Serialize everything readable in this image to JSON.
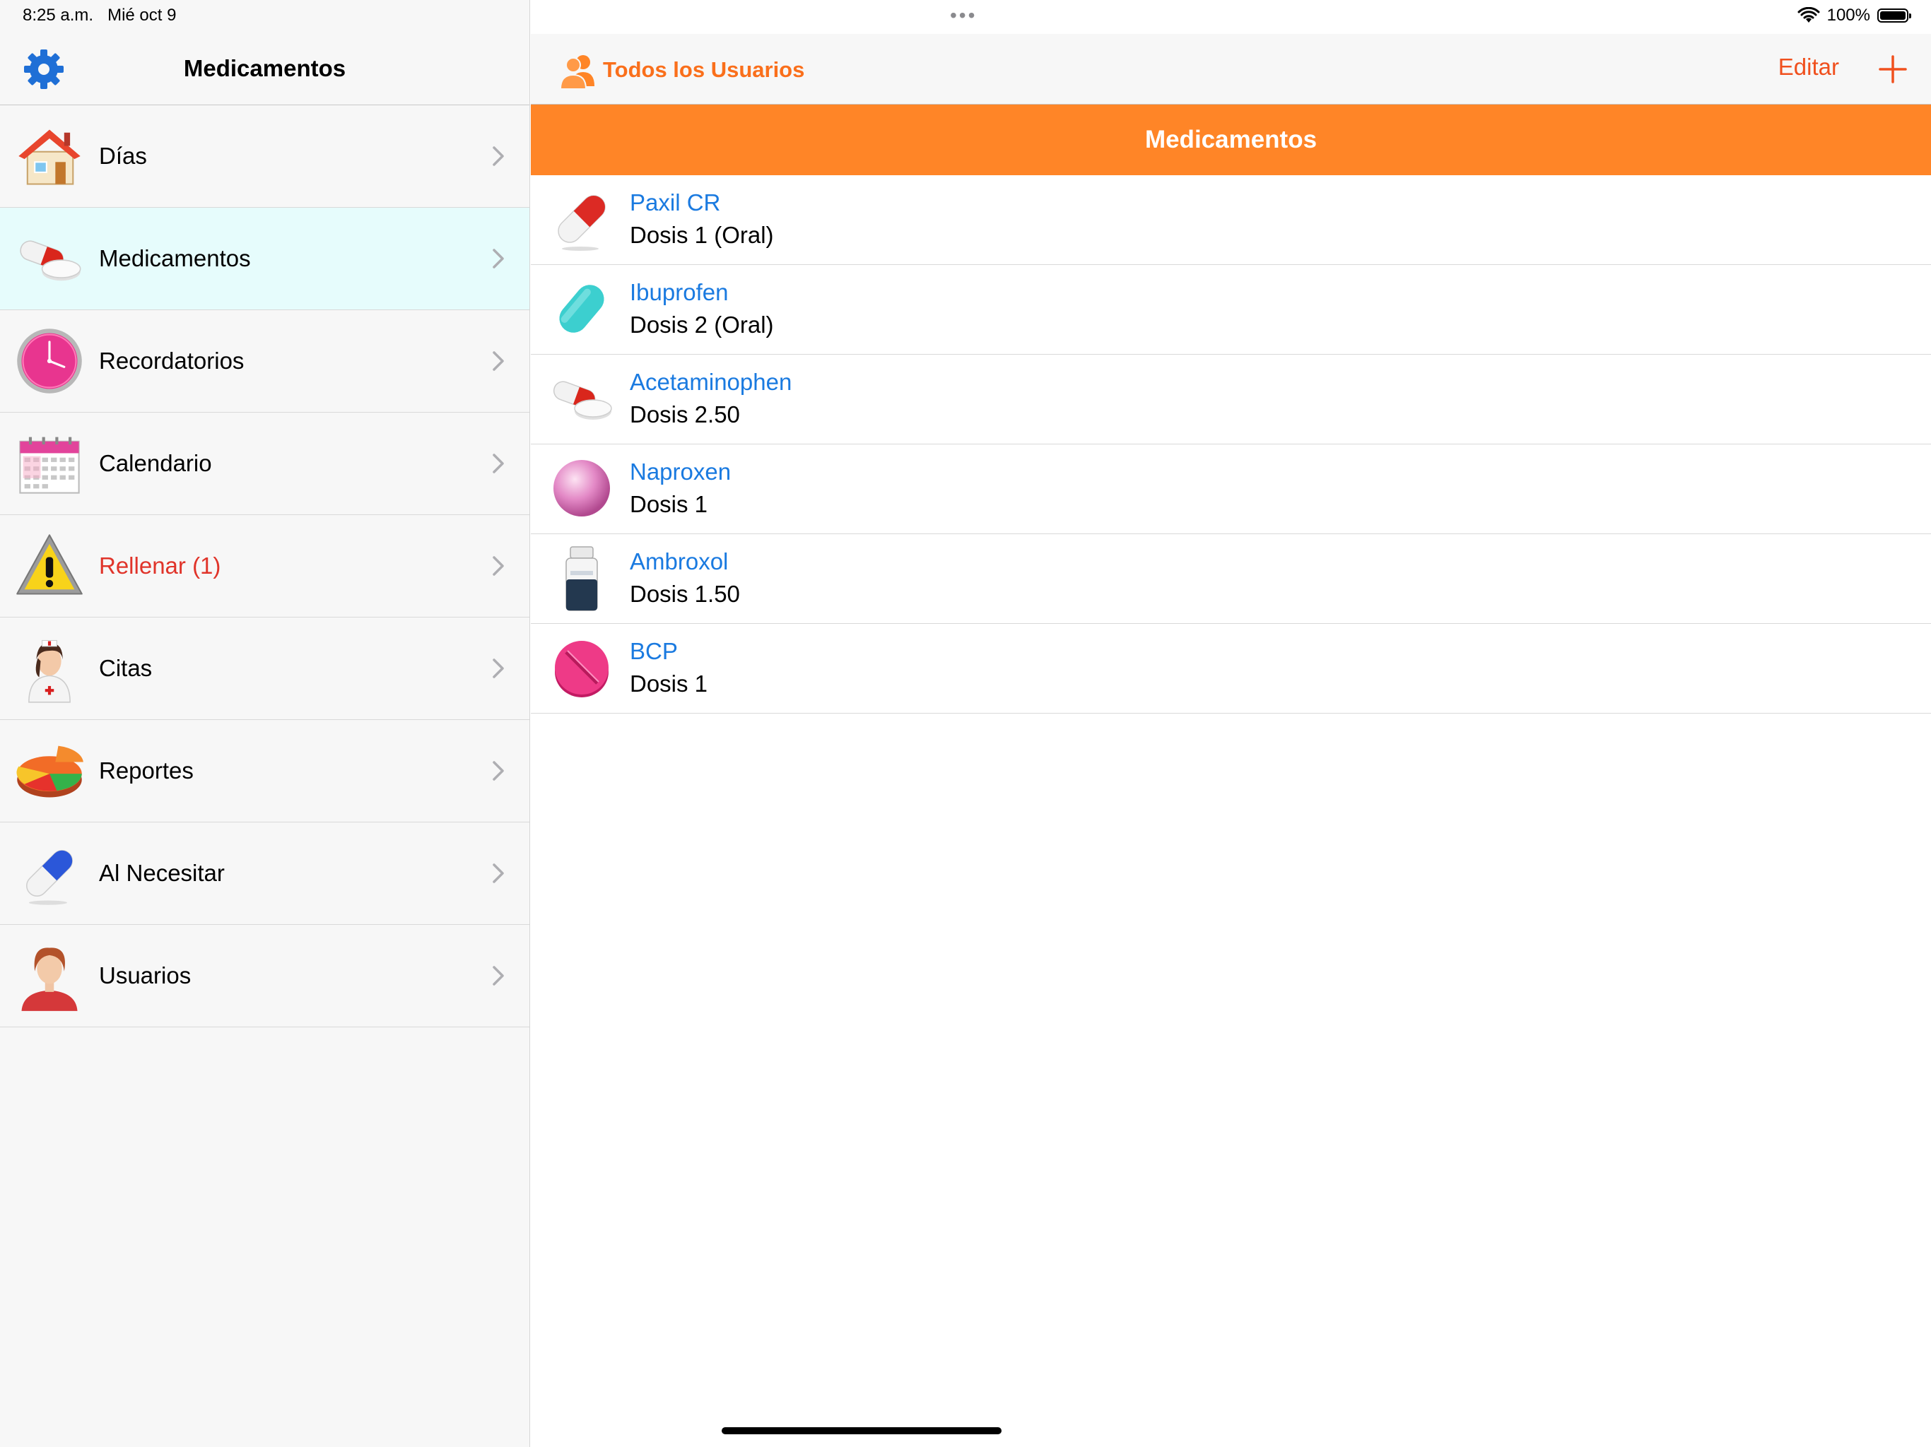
{
  "status": {
    "time": "8:25 a.m.",
    "date": "Mié oct 9",
    "battery": "100%",
    "battery_level": 1.0
  },
  "sidebar": {
    "title": "Medicamentos",
    "items": [
      {
        "label": "Días",
        "icon": "house-icon"
      },
      {
        "label": "Medicamentos",
        "icon": "pills-icon",
        "selected": true
      },
      {
        "label": "Recordatorios",
        "icon": "clock-icon"
      },
      {
        "label": "Calendario",
        "icon": "calendar-icon"
      },
      {
        "label": "Rellenar (1)",
        "icon": "warning-icon",
        "alert": true
      },
      {
        "label": "Citas",
        "icon": "nurse-icon"
      },
      {
        "label": "Reportes",
        "icon": "pie-chart-icon"
      },
      {
        "label": "Al Necesitar",
        "icon": "capsule-icon"
      },
      {
        "label": "Usuarios",
        "icon": "user-avatar-icon"
      }
    ]
  },
  "detail": {
    "users_label": "Todos los Usuarios",
    "edit_label": "Editar",
    "section_title": "Medicamentos",
    "medications": [
      {
        "name": "Paxil CR",
        "dose": "Dosis 1 (Oral)",
        "icon": "red-capsule-icon"
      },
      {
        "name": "Ibuprofen",
        "dose": "Dosis 2 (Oral)",
        "icon": "teal-tablet-icon"
      },
      {
        "name": "Acetaminophen",
        "dose": "Dosis 2.50",
        "icon": "pills-icon"
      },
      {
        "name": "Naproxen",
        "dose": "Dosis 1",
        "icon": "pink-ball-icon"
      },
      {
        "name": "Ambroxol",
        "dose": "Dosis 1.50",
        "icon": "bottle-icon"
      },
      {
        "name": "BCP",
        "dose": "Dosis 1",
        "icon": "pink-tablet-icon"
      }
    ]
  },
  "colors": {
    "accent": "#ff8527",
    "link": "#1a7ae0",
    "alert": "#e0342a",
    "selected": "#e6fcfc",
    "nav_tint": "#f0501e"
  }
}
